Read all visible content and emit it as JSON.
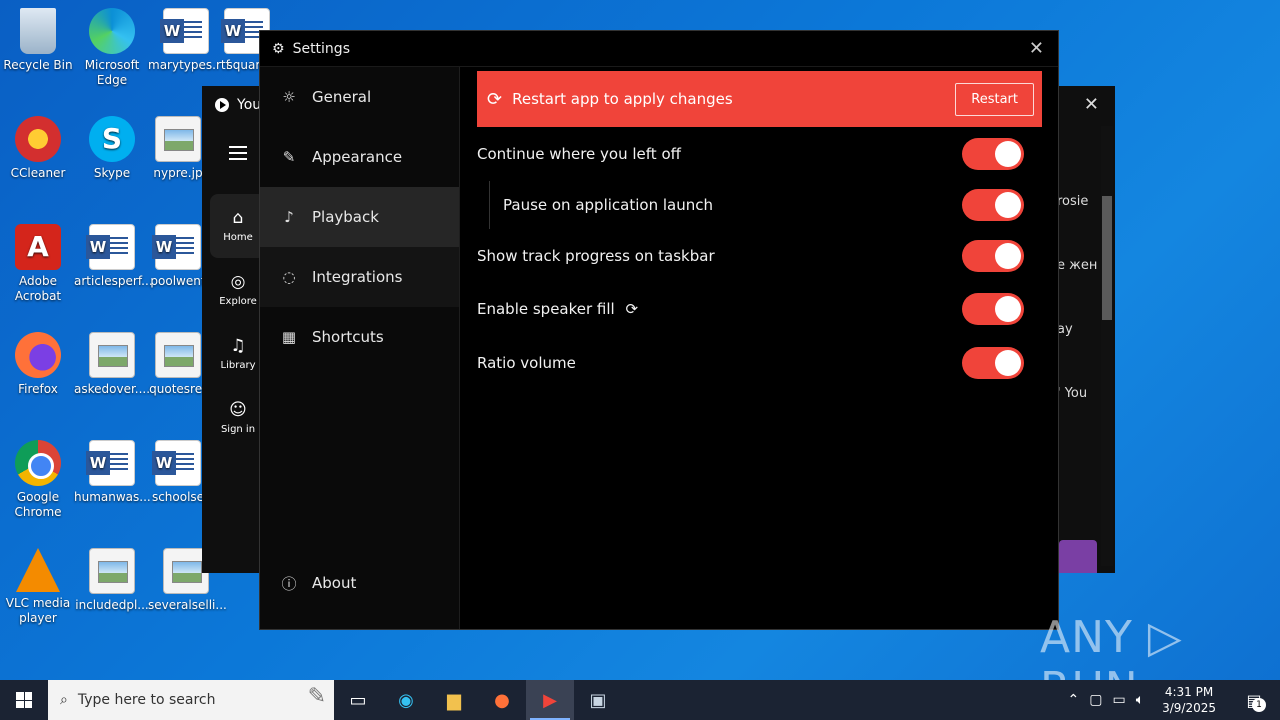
{
  "desktop": {
    "icons": [
      {
        "label": "Recycle Bin"
      },
      {
        "label": "Microsoft Edge"
      },
      {
        "label": "marytypes.rtf"
      },
      {
        "label": "square"
      },
      {
        "label": "CCleaner"
      },
      {
        "label": "Skype"
      },
      {
        "label": "nypre.jp"
      },
      {
        "label": "Adobe Acrobat"
      },
      {
        "label": "articlesperf..."
      },
      {
        "label": "poolwent"
      },
      {
        "label": "Firefox"
      },
      {
        "label": "askedover...."
      },
      {
        "label": "quotesret"
      },
      {
        "label": "Google Chrome"
      },
      {
        "label": "humanwas..."
      },
      {
        "label": "schoolse"
      },
      {
        "label": "VLC media player"
      },
      {
        "label": "includedpl..."
      },
      {
        "label": "severalselli..."
      }
    ]
  },
  "bg_window": {
    "title": "You",
    "rail": [
      {
        "label": "Home",
        "icon": "⌂"
      },
      {
        "label": "Explore",
        "icon": "◎"
      },
      {
        "label": "Library",
        "icon": "♫"
      },
      {
        "label": "Sign in",
        "icon": "☺"
      }
    ],
    "side_text": [
      "rosie",
      "е жен",
      "ay",
      "' You"
    ]
  },
  "settings": {
    "title": "Settings",
    "nav": [
      {
        "label": "General",
        "icon": "☼"
      },
      {
        "label": "Appearance",
        "icon": "✎"
      },
      {
        "label": "Playback",
        "icon": "♪"
      },
      {
        "label": "Integrations",
        "icon": "◌"
      },
      {
        "label": "Shortcuts",
        "icon": "▦"
      }
    ],
    "about_label": "About",
    "active_nav": "Playback",
    "banner": {
      "text": "Restart app to apply changes",
      "button": "Restart"
    },
    "options": [
      {
        "label": "Continue where you left off",
        "enabled": true
      },
      {
        "label": "Pause on application launch",
        "enabled": true
      },
      {
        "label": "Show track progress on taskbar",
        "enabled": true
      },
      {
        "label": "Enable speaker fill",
        "enabled": true
      },
      {
        "label": "Ratio volume",
        "enabled": true
      }
    ],
    "accent": "#f0443a"
  },
  "watermark": "ANY ▷ RUN",
  "taskbar": {
    "search_placeholder": "Type here to search",
    "time": "4:31 PM",
    "date": "3/9/2025",
    "notifications": "1"
  }
}
